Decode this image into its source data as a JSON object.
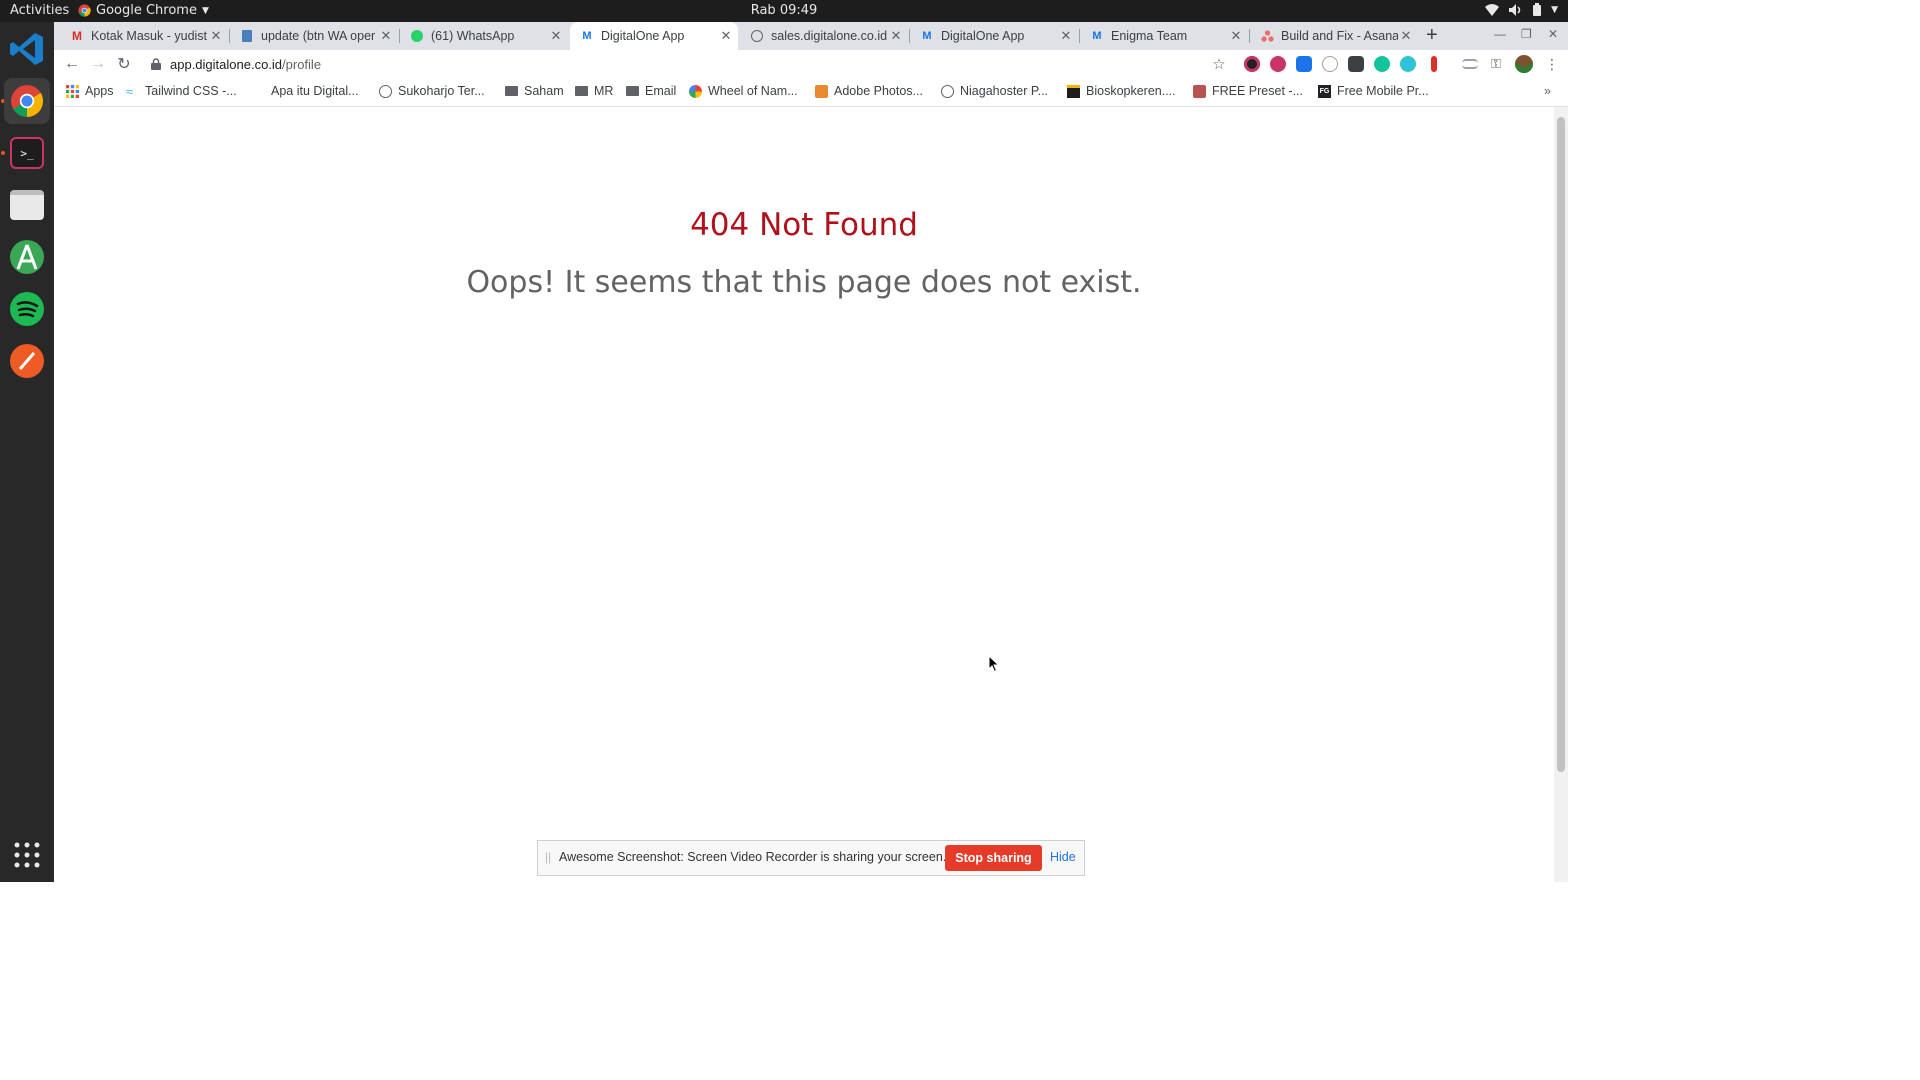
{
  "topbar": {
    "activities": "Activities",
    "app_name": "Google Chrome",
    "clock": "Rab 09:49"
  },
  "dock": {
    "items": [
      {
        "icon": "vscode-icon",
        "active": false
      },
      {
        "icon": "chrome-icon",
        "active": true
      },
      {
        "icon": "terminal-icon",
        "active": false
      },
      {
        "icon": "files-icon",
        "active": false
      },
      {
        "icon": "android-studio-icon",
        "active": false
      },
      {
        "icon": "spotify-icon",
        "active": false
      },
      {
        "icon": "postman-icon",
        "active": false
      },
      {
        "icon": "app-grid-icon",
        "active": false
      }
    ]
  },
  "tabs": [
    {
      "title": "Kotak Masuk - yudist",
      "icon": "gmail-icon"
    },
    {
      "title": "update (btn WA oper",
      "icon": "docs-icon"
    },
    {
      "title": "(61) WhatsApp",
      "icon": "whatsapp-icon"
    },
    {
      "title": "DigitalOne App",
      "icon": "digitalone-icon",
      "active": true
    },
    {
      "title": "sales.digitalone.co.id",
      "icon": "globe-icon"
    },
    {
      "title": "DigitalOne App",
      "icon": "digitalone-icon"
    },
    {
      "title": "Enigma Team",
      "icon": "digitalone-icon"
    },
    {
      "title": "Build and Fix - Asana",
      "icon": "asana-icon"
    }
  ],
  "toolbar": {
    "url_host": "app.digitalone.co.id",
    "url_path": "/profile"
  },
  "bookmarks": [
    {
      "label": "Apps",
      "icon": "apps-grid-icon"
    },
    {
      "label": "Tailwind CSS -...",
      "icon": "tailwind-icon"
    },
    {
      "label": "Apa itu Digital...",
      "icon": "blank-icon"
    },
    {
      "label": "Sukoharjo Ter...",
      "icon": "globe-icon"
    },
    {
      "label": "Saham",
      "icon": "folder-icon"
    },
    {
      "label": "MR",
      "icon": "folder-icon"
    },
    {
      "label": "Email",
      "icon": "folder-icon"
    },
    {
      "label": "Wheel of Nam...",
      "icon": "wheel-icon"
    },
    {
      "label": "Adobe Photos...",
      "icon": "adobe-icon"
    },
    {
      "label": "Niagahoster P...",
      "icon": "globe-icon"
    },
    {
      "label": "Bioskopkeren....",
      "icon": "film-icon"
    },
    {
      "label": "FREE Preset -...",
      "icon": "preset-icon"
    },
    {
      "label": "Free Mobile Pr...",
      "icon": "fg-icon"
    }
  ],
  "page": {
    "error_code": "404 Not Found",
    "error_message": "Oops! It seems that this page does not exist."
  },
  "sharebar": {
    "message": "Awesome Screenshot: Screen Video Recorder is sharing your screen.",
    "stop_label": "Stop sharing",
    "hide_label": "Hide"
  },
  "colors": {
    "error_red": "#b0111b",
    "stop_button": "#e73b2a"
  }
}
